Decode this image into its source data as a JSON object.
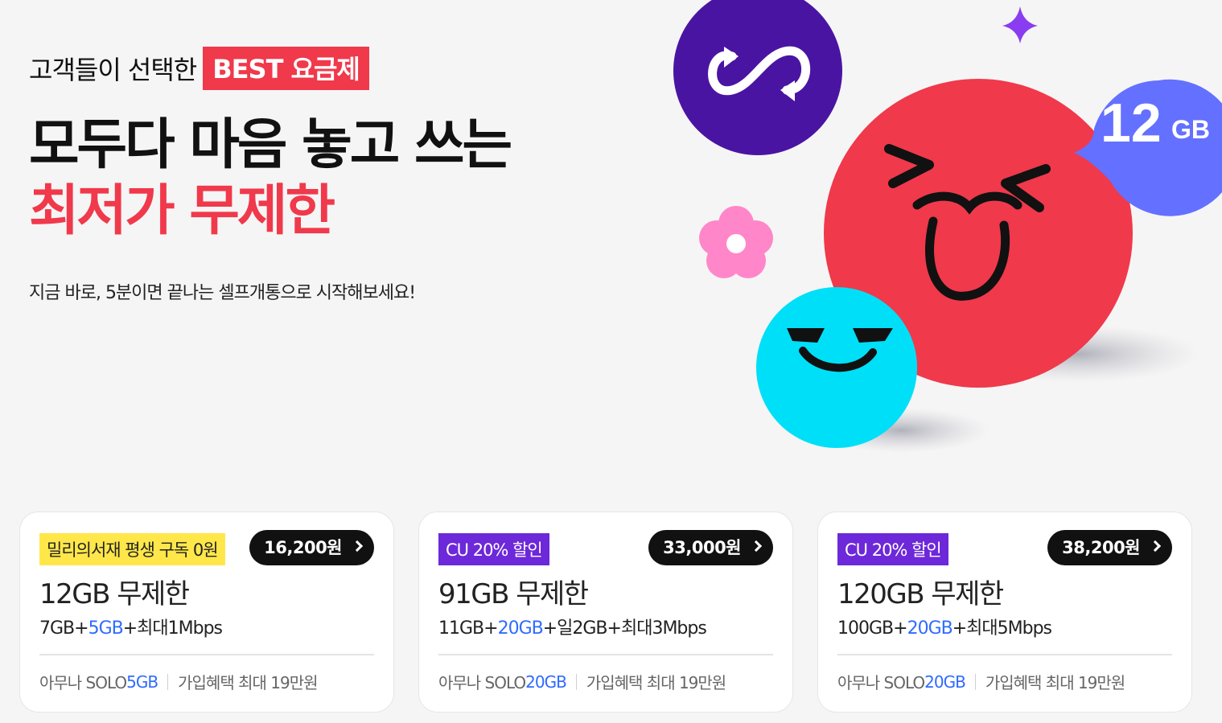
{
  "hero": {
    "eyebrow": "고객들이 선택한",
    "best_tag": "BEST 요금제",
    "headline_line1": "모두다 마음 놓고 쓰는",
    "headline_line2": "최저가 무제한",
    "subline": "지금 바로, 5분이면 끝나는 셀프개통으로 시작해보세요!"
  },
  "art": {
    "bubble_number": "12",
    "bubble_unit": "GB",
    "icons": [
      "infinity-refresh-icon",
      "sparkle-icon",
      "flower-icon",
      "laughing-face-character",
      "smirking-face-character"
    ],
    "colors": {
      "purple": "#4a14a3",
      "red": "#f0394b",
      "cyan": "#00dff8",
      "periwinkle": "#6470ff",
      "pink": "#ff86c8",
      "violet": "#8a3cf0"
    }
  },
  "cards": [
    {
      "badge": "밀리의서재 평생 구독 0원",
      "badge_style": "yellow",
      "price": "16,200원",
      "plan_name": "12GB 무제한",
      "detail_a": "7GB+",
      "detail_b": "5GB",
      "detail_c": "+최대1Mbps",
      "foot_a": "아무나 SOLO ",
      "foot_b": "5GB",
      "foot_c": "가입혜택 최대 19만원"
    },
    {
      "badge": "CU 20% 할인",
      "badge_style": "purple",
      "price": "33,000원",
      "plan_name": "91GB 무제한",
      "detail_a": "11GB+",
      "detail_b": "20GB",
      "detail_c": "+일2GB+최대3Mbps",
      "foot_a": "아무나 SOLO ",
      "foot_b": "20GB",
      "foot_c": "가입혜택 최대 19만원"
    },
    {
      "badge": "CU 20% 할인",
      "badge_style": "purple",
      "price": "38,200원",
      "plan_name": "120GB 무제한",
      "detail_a": "100GB+",
      "detail_b": "20GB",
      "detail_c": "+최대5Mbps",
      "foot_a": "아무나 SOLO ",
      "foot_b": "20GB",
      "foot_c": "가입혜택 최대 19만원"
    }
  ]
}
